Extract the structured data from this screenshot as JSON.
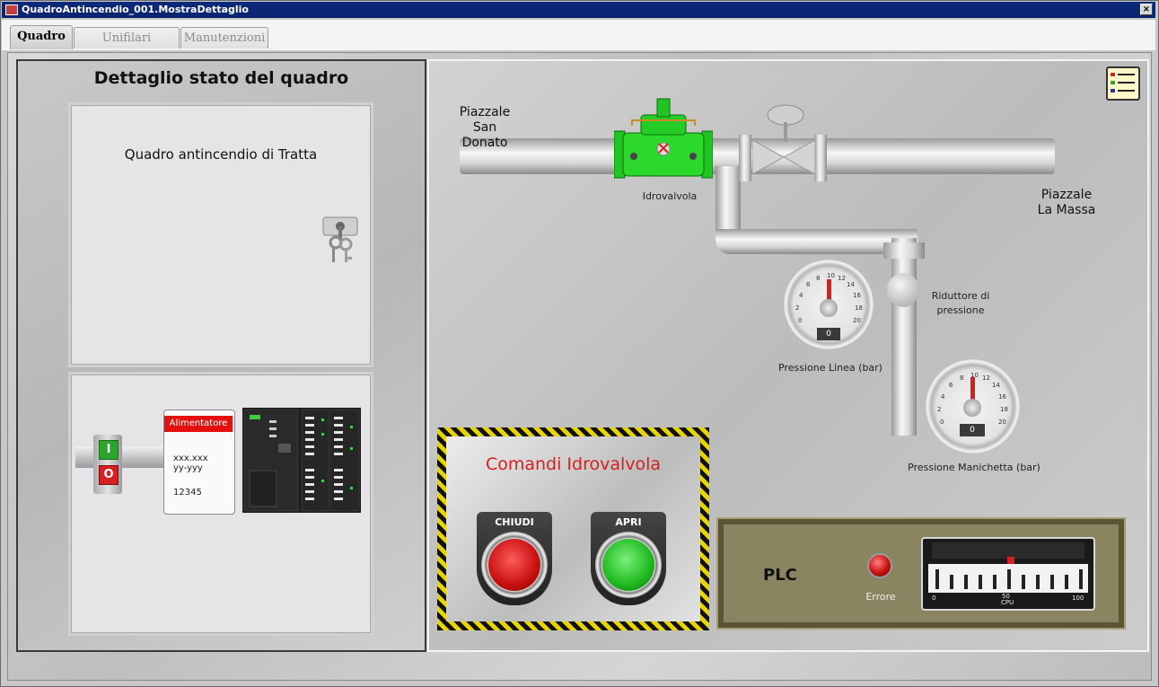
{
  "window": {
    "title": "QuadroAntincendio_001.MostraDettaglio",
    "close_glyph": "×"
  },
  "tabs": [
    {
      "label": "Quadro",
      "active": true
    },
    {
      "label": "Unifilari",
      "active": false
    },
    {
      "label": "Manutenzioni",
      "active": false
    }
  ],
  "left": {
    "heading": "Dettaglio stato del quadro",
    "quadro_name": "Quadro antincendio di Tratta",
    "key_icon": "keys-icon",
    "power_module": {
      "header": "Alimentatore",
      "line1": "xxx.xxx",
      "line2": "yy-yyy",
      "line3": "12345"
    },
    "switch_on_label": "I",
    "switch_off_label": "O"
  },
  "diagram": {
    "from_label_1": "Piazzale",
    "from_label_2": "San Donato",
    "to_label_1": "Piazzale",
    "to_label_2": "La Massa",
    "valve_label": "Idrovalvola",
    "reducer_label_1": "Riduttore di",
    "reducer_label_2": "pressione",
    "gauge_line": {
      "label": "Pressione Linea (bar)",
      "value": "0",
      "ticks": [
        "0",
        "2",
        "4",
        "6",
        "8",
        "10",
        "12",
        "14",
        "16",
        "18",
        "20"
      ]
    },
    "gauge_hose": {
      "label": "Pressione Manichetta (bar)",
      "value": "0",
      "ticks": [
        "0",
        "2",
        "4",
        "6",
        "8",
        "10",
        "12",
        "14",
        "16",
        "18",
        "20"
      ]
    },
    "legend_icon": "legend-list-icon"
  },
  "commands": {
    "title": "Comandi Idrovalvola",
    "close_label": "CHIUDI",
    "open_label": "APRI",
    "title_color": "#d42020"
  },
  "plc": {
    "label": "PLC",
    "error_label": "Errore",
    "cpu_label": "CPU",
    "scale_min": "0",
    "scale_mid": "50",
    "scale_max": "100",
    "cpu_load_percent": 50
  }
}
